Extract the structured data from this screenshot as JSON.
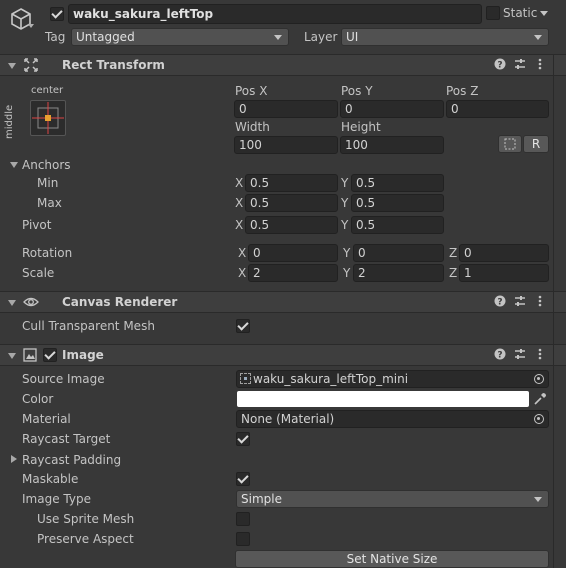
{
  "object": {
    "name": "waku_sakura_leftTop",
    "static_label": "Static",
    "tag_label": "Tag",
    "tag_value": "Untagged",
    "layer_label": "Layer",
    "layer_value": "UI"
  },
  "rect_transform": {
    "title": "Rect Transform",
    "anchor_h": "center",
    "anchor_v": "middle",
    "posx_label": "Pos X",
    "posy_label": "Pos Y",
    "posz_label": "Pos Z",
    "posx": "0",
    "posy": "0",
    "posz": "0",
    "width_label": "Width",
    "height_label": "Height",
    "width": "100",
    "height": "100",
    "r_button": "R",
    "anchors_label": "Anchors",
    "min_label": "Min",
    "max_label": "Max",
    "pivot_label": "Pivot",
    "x_axis": "X",
    "y_axis": "Y",
    "z_axis": "Z",
    "min_x": "0.5",
    "min_y": "0.5",
    "max_x": "0.5",
    "max_y": "0.5",
    "pivot_x": "0.5",
    "pivot_y": "0.5",
    "rotation_label": "Rotation",
    "rot_x": "0",
    "rot_y": "0",
    "rot_z": "0",
    "scale_label": "Scale",
    "scale_x": "2",
    "scale_y": "2",
    "scale_z": "1"
  },
  "canvas_renderer": {
    "title": "Canvas Renderer",
    "cull_label": "Cull Transparent Mesh",
    "cull_checked": true
  },
  "image": {
    "title": "Image",
    "source_label": "Source Image",
    "source_value": "waku_sakura_leftTop_mini",
    "color_label": "Color",
    "color_value": "#ffffff",
    "material_label": "Material",
    "material_value": "None (Material)",
    "raycast_target_label": "Raycast Target",
    "raycast_padding_label": "Raycast Padding",
    "maskable_label": "Maskable",
    "image_type_label": "Image Type",
    "image_type_value": "Simple",
    "use_sprite_mesh_label": "Use Sprite Mesh",
    "preserve_aspect_label": "Preserve Aspect",
    "native_size_button": "Set Native Size"
  }
}
